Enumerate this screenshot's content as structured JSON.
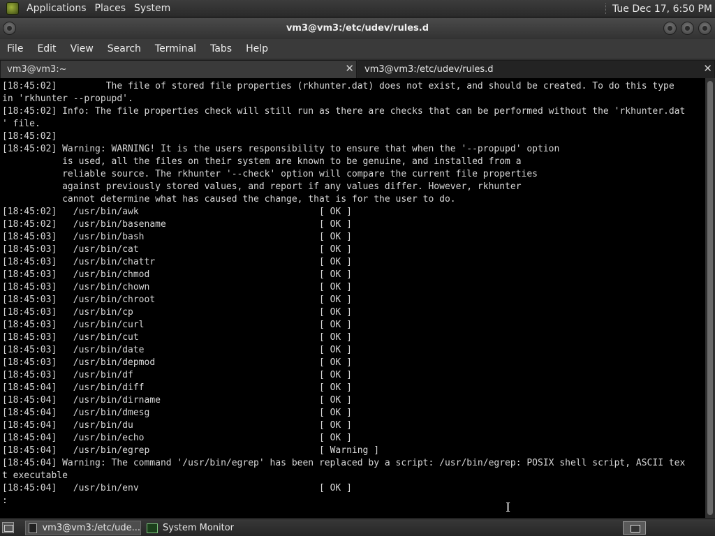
{
  "top_panel": {
    "menus": [
      "Applications",
      "Places",
      "System"
    ],
    "clock": "Tue Dec 17,  6:50 PM"
  },
  "window": {
    "title": "vm3@vm3:/etc/udev/rules.d"
  },
  "menubar": {
    "items": [
      "File",
      "Edit",
      "View",
      "Search",
      "Terminal",
      "Tabs",
      "Help"
    ]
  },
  "tabs": [
    {
      "label": "vm3@vm3:~",
      "close": "✕",
      "active": false
    },
    {
      "label": "vm3@vm3:/etc/udev/rules.d",
      "close": "✕",
      "active": true
    }
  ],
  "terminal": {
    "lines": [
      "[18:45:02]         The file of stored file properties (rkhunter.dat) does not exist, and should be created. To do this type",
      "in 'rkhunter --propupd'.",
      "[18:45:02] Info: The file properties check will still run as there are checks that can be performed without the 'rkhunter.dat",
      "' file.",
      "[18:45:02]",
      "[18:45:02] Warning: WARNING! It is the users responsibility to ensure that when the '--propupd' option",
      "           is used, all the files on their system are known to be genuine, and installed from a",
      "           reliable source. The rkhunter '--check' option will compare the current file properties",
      "           against previously stored values, and report if any values differ. However, rkhunter",
      "           cannot determine what has caused the change, that is for the user to do.",
      "[18:45:02]   /usr/bin/awk                                 [ OK ]",
      "[18:45:02]   /usr/bin/basename                            [ OK ]",
      "[18:45:03]   /usr/bin/bash                                [ OK ]",
      "[18:45:03]   /usr/bin/cat                                 [ OK ]",
      "[18:45:03]   /usr/bin/chattr                              [ OK ]",
      "[18:45:03]   /usr/bin/chmod                               [ OK ]",
      "[18:45:03]   /usr/bin/chown                               [ OK ]",
      "[18:45:03]   /usr/bin/chroot                              [ OK ]",
      "[18:45:03]   /usr/bin/cp                                  [ OK ]",
      "[18:45:03]   /usr/bin/curl                                [ OK ]",
      "[18:45:03]   /usr/bin/cut                                 [ OK ]",
      "[18:45:03]   /usr/bin/date                                [ OK ]",
      "[18:45:03]   /usr/bin/depmod                              [ OK ]",
      "[18:45:03]   /usr/bin/df                                  [ OK ]",
      "[18:45:04]   /usr/bin/diff                                [ OK ]",
      "[18:45:04]   /usr/bin/dirname                             [ OK ]",
      "[18:45:04]   /usr/bin/dmesg                               [ OK ]",
      "[18:45:04]   /usr/bin/du                                  [ OK ]",
      "[18:45:04]   /usr/bin/echo                                [ OK ]",
      "[18:45:04]   /usr/bin/egrep                               [ Warning ]",
      "[18:45:04] Warning: The command '/usr/bin/egrep' has been replaced by a script: /usr/bin/egrep: POSIX shell script, ASCII tex",
      "t executable",
      "[18:45:04]   /usr/bin/env                                 [ OK ]",
      ":"
    ]
  },
  "taskbar": {
    "items": [
      "vm3@vm3:/etc/ude...",
      "System Monitor"
    ]
  }
}
